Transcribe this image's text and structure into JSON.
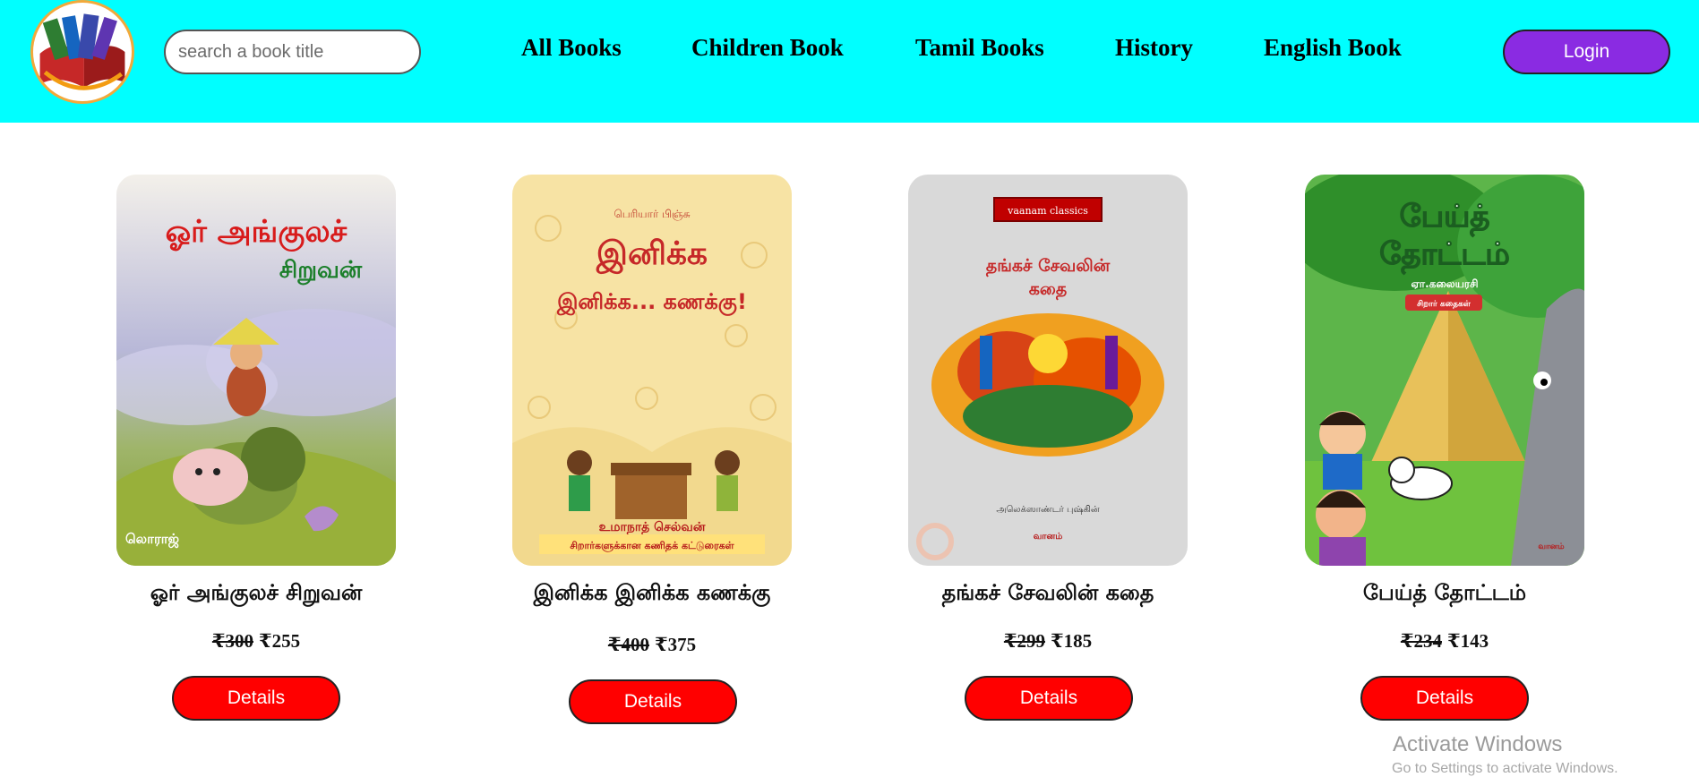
{
  "header": {
    "search_placeholder": "search a book title",
    "nav": [
      "All Books",
      "Children Book",
      "Tamil Books",
      "History",
      "English Book"
    ],
    "login_label": "Login",
    "background_color": "#00ffff"
  },
  "books": [
    {
      "title": "ஓர் அங்குலச் சிறுவன்",
      "old_price": "₹300",
      "price": "₹255",
      "details_label": "Details",
      "cover": {
        "main": "ஓர் அங்குலச்",
        "sub": "சிறுவன்",
        "author": "லொராஜ்"
      }
    },
    {
      "title": "இனிக்க இனிக்க கணக்கு",
      "old_price": "₹400",
      "price": "₹375",
      "details_label": "Details",
      "cover": {
        "main": "இனிக்க",
        "sub": "இனிக்க... கணக்கு!",
        "author": "உமாநாத் செல்வன்",
        "footer": "சிறார்களுக்கான கணிதக் கட்டுரைகள்"
      }
    },
    {
      "title": "தங்கச் சேவலின் கதை",
      "old_price": "₹299",
      "price": "₹185",
      "details_label": "Details",
      "cover": {
        "badge": "vaanam classics",
        "main": "தங்கச் சேவலின்",
        "sub": "கதை",
        "author": "அலெக்ஸாண்டர் புஷ்கின்",
        "publisher": "வானம்"
      }
    },
    {
      "title": "பேய்த் தோட்டம்",
      "old_price": "₹234",
      "price": "₹143",
      "details_label": "Details",
      "cover": {
        "main": "பேய்த்",
        "sub": "தோட்டம்",
        "author": "ஏா.கலையரசி",
        "tag": "சிறார் கதைகள்",
        "publisher": "வானம்"
      }
    }
  ],
  "watermark": {
    "title": "Activate Windows",
    "subtitle": "Go to Settings to activate Windows."
  },
  "colors": {
    "details_button": "#ff0000",
    "login_button": "#8a2be2"
  }
}
